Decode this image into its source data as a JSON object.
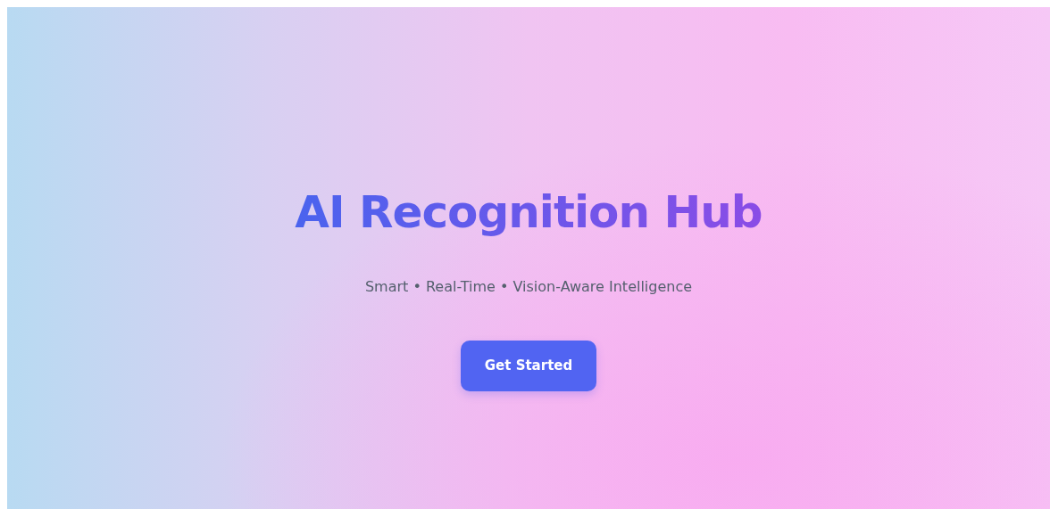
{
  "hero": {
    "title": "AI Recognition Hub",
    "subtitle": "Smart • Real-Time • Vision-Aware Intelligence",
    "button": "Get Started"
  }
}
